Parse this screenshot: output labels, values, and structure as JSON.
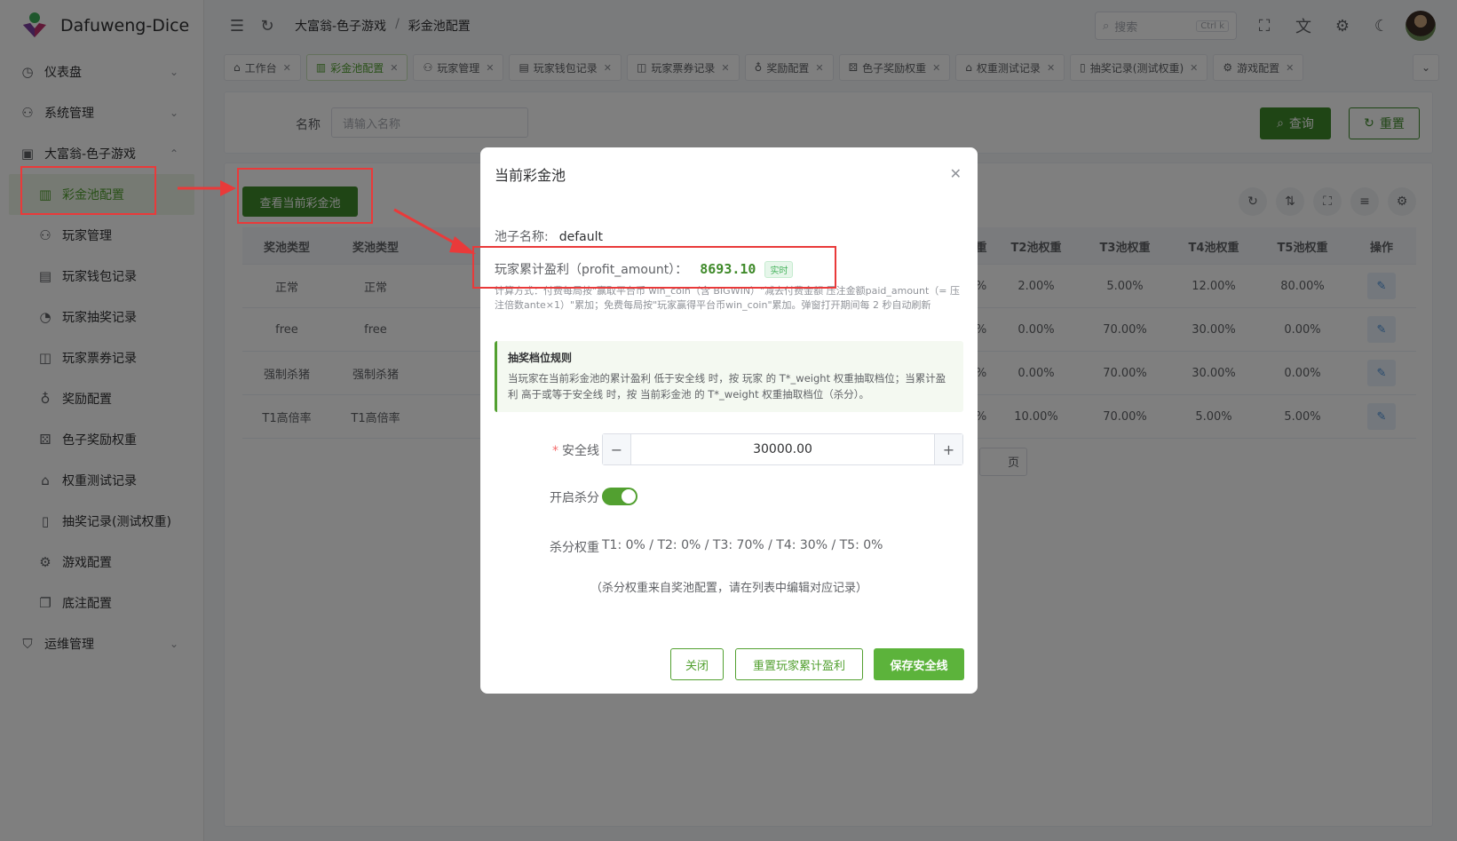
{
  "app": {
    "title": "Dafuweng-Dice"
  },
  "sidebar": {
    "items": [
      {
        "label": "仪表盘",
        "icon": "dashboard-icon",
        "expandable": true
      },
      {
        "label": "系统管理",
        "icon": "user-icon",
        "expandable": true
      },
      {
        "label": "大富翁-色子游戏",
        "icon": "gamepad-icon",
        "expandable": true,
        "expanded": true
      }
    ],
    "submenu": [
      {
        "label": "彩金池配置",
        "icon": "chart-icon",
        "active": true
      },
      {
        "label": "玩家管理",
        "icon": "user-icon"
      },
      {
        "label": "玩家钱包记录",
        "icon": "wallet-icon"
      },
      {
        "label": "玩家抽奖记录",
        "icon": "record-icon"
      },
      {
        "label": "玩家票券记录",
        "icon": "ticket-icon"
      },
      {
        "label": "奖励配置",
        "icon": "medal-icon"
      },
      {
        "label": "色子奖励权重",
        "icon": "dice-icon"
      },
      {
        "label": "权重测试记录",
        "icon": "home-icon"
      },
      {
        "label": "抽奖记录(测试权重)",
        "icon": "tube-icon"
      },
      {
        "label": "游戏配置",
        "icon": "config-icon"
      },
      {
        "label": "底注配置",
        "icon": "copy-icon"
      }
    ],
    "footer_item": {
      "label": "运维管理",
      "icon": "shield-icon",
      "expandable": true
    }
  },
  "header": {
    "breadcrumb": [
      "大富翁-色子游戏",
      "彩金池配置"
    ],
    "search_placeholder": "搜索",
    "search_shortcut": "Ctrl k"
  },
  "tabs": [
    {
      "label": "工作台",
      "icon": "home-icon"
    },
    {
      "label": "彩金池配置",
      "icon": "chart-icon",
      "active": true
    },
    {
      "label": "玩家管理",
      "icon": "user-icon"
    },
    {
      "label": "玩家钱包记录",
      "icon": "wallet-icon"
    },
    {
      "label": "玩家票券记录",
      "icon": "ticket-icon"
    },
    {
      "label": "奖励配置",
      "icon": "medal-icon"
    },
    {
      "label": "色子奖励权重",
      "icon": "dice-icon"
    },
    {
      "label": "权重测试记录",
      "icon": "home-icon"
    },
    {
      "label": "抽奖记录(测试权重)",
      "icon": "tube-icon"
    },
    {
      "label": "游戏配置",
      "icon": "config-icon"
    }
  ],
  "search_form": {
    "name_label": "名称",
    "name_placeholder": "请输入名称",
    "query_label": "查询",
    "reset_label": "重置"
  },
  "table": {
    "view_button": "查看当前彩金池",
    "headers_left": [
      "奖池类型",
      "奖池类型"
    ],
    "headers_right": [
      "T2池权重",
      "T3池权重",
      "T4池权重",
      "T5池权重",
      "操作"
    ],
    "partial_header": "重",
    "rows": [
      {
        "c1": "正常",
        "c2": "正常",
        "partial": "%",
        "t2": "2.00%",
        "t3": "5.00%",
        "t4": "12.00%",
        "t5": "80.00%"
      },
      {
        "c1": "free",
        "c2": "free",
        "partial": "%",
        "t2": "0.00%",
        "t3": "70.00%",
        "t4": "30.00%",
        "t5": "0.00%"
      },
      {
        "c1": "强制杀猪",
        "c2": "强制杀猪",
        "partial": "%",
        "t2": "0.00%",
        "t3": "70.00%",
        "t4": "30.00%",
        "t5": "0.00%"
      },
      {
        "c1": "T1高倍率",
        "c2": "T1高倍率",
        "partial": "%",
        "t2": "10.00%",
        "t3": "70.00%",
        "t4": "5.00%",
        "t5": "5.00%"
      }
    ],
    "pager_suffix": "页"
  },
  "dialog": {
    "title": "当前彩金池",
    "pool_name_label": "池子名称:",
    "pool_name_value": "default",
    "profit_label": "玩家累计盈利（profit_amount）：",
    "profit_value": "8693.10",
    "live_tag": "实时",
    "calc_note": "计算方式：付费每局按\"赢取平台币 win_coin（含 BIGWIN）\"减去付费金额 压注金额paid_amount（= 压注倍数ante×1）\"累加；免费每局按\"玩家赢得平台币win_coin\"累加。弹窗打开期间每 2 秒自动刷新",
    "rule_title": "抽奖档位规则",
    "rule_text": "当玩家在当前彩金池的累计盈利 低于安全线 时，按 玩家 的 T*_weight 权重抽取档位；当累计盈利 高于或等于安全线 时，按 当前彩金池 的 T*_weight 权重抽取档位（杀分）。",
    "safety_label": "安全线",
    "safety_value": "30000.00",
    "kill_label": "开启杀分",
    "kill_enabled": true,
    "kill_weight_label": "杀分权重",
    "kill_weight_value": "T1: 0% / T2: 0% / T3: 70% / T4: 30% / T5: 0%",
    "kill_note": "（杀分权重来自奖池配置，请在列表中编辑对应记录）",
    "close_label": "关闭",
    "reset_profit_label": "重置玩家累计盈利",
    "save_label": "保存安全线"
  },
  "colors": {
    "accent": "#52a030",
    "annotation": "#e93a3a"
  }
}
